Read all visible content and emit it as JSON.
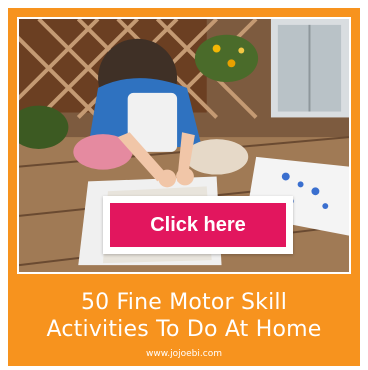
{
  "promo": {
    "button_label": "Click here",
    "title_line1": "50 Fine Motor Skill",
    "title_line2": "Activities To Do At Home",
    "url": "www.jojoebi.com"
  },
  "colors": {
    "background": "#f7931e",
    "button": "#e2165e",
    "text": "#ffffff"
  }
}
